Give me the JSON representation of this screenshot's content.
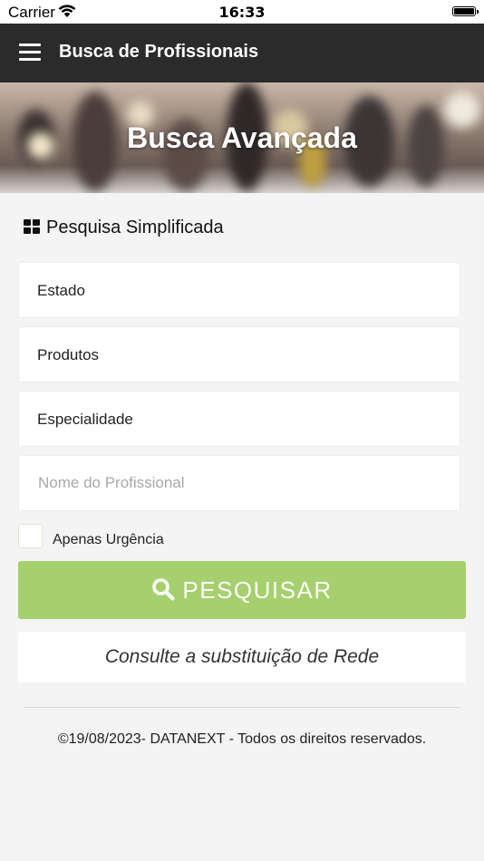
{
  "status_bar": {
    "carrier": "Carrier",
    "time": "16:33"
  },
  "navbar": {
    "menu_icon": "hamburger-menu-icon",
    "title": "Busca de Profissionais"
  },
  "banner": {
    "title": "Busca Avançada"
  },
  "section": {
    "icon": "grid-icon",
    "label": "Pesquisa Simplificada"
  },
  "form": {
    "estado_label": "Estado",
    "produtos_label": "Produtos",
    "especialidade_label": "Especialidade",
    "nome_placeholder": "Nome do Profissional",
    "nome_value": "",
    "urgencia_label": "Apenas Urgência",
    "urgencia_checked": false
  },
  "actions": {
    "search_label": "PESQUISAR",
    "search_icon": "search-icon",
    "search_color": "#a5d06d",
    "rede_label": "Consulte a substituição de Rede"
  },
  "footer": {
    "text": "©19/08/2023- DATANEXT - Todos os direitos reservados."
  }
}
